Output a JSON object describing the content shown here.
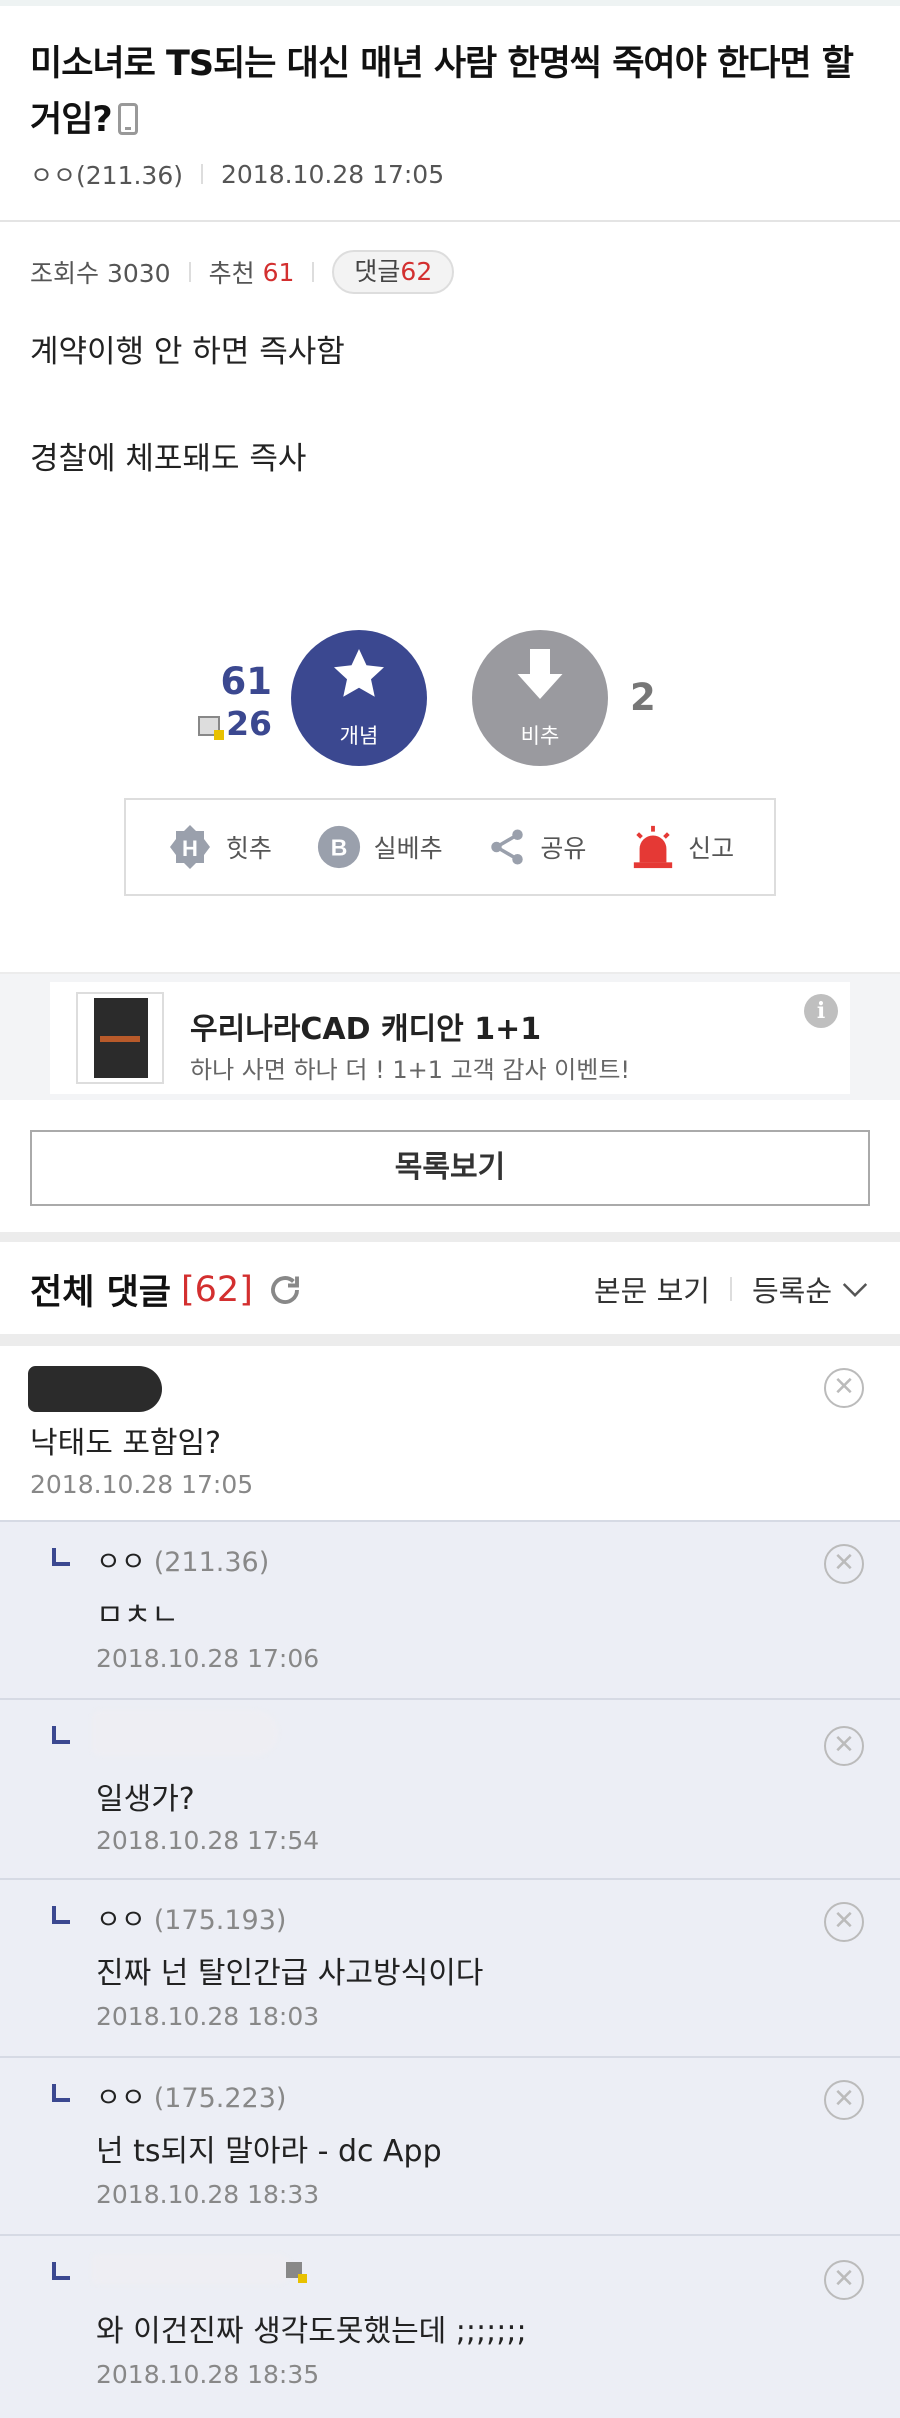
{
  "post": {
    "title": "미소녀로 TS되는 대신 매년 사람 한명씩 죽여야 한다면 할거임?",
    "author": "ㅇㅇ(211.36)",
    "date": "2018.10.28 17:05",
    "views_label": "조회수 3030",
    "recommend_label": "추천",
    "recommend_count": "61",
    "comments_label": "댓글",
    "comments_count": "62",
    "body_line1": "계약이행 안 하면 즉사함",
    "body_line2": "경찰에 체포돼도 즉사"
  },
  "vote": {
    "up_count": "61",
    "fix_count": "26",
    "up_label": "개념",
    "down_label": "비추",
    "down_count": "2"
  },
  "actions": {
    "hit": "힛추",
    "real": "실베추",
    "share": "공유",
    "report": "신고"
  },
  "ad": {
    "title": "우리나라CAD 캐디안 1+1",
    "subtitle": "하나 사면 하나 더 ! 1+1 고객 감사 이벤트!",
    "info_icon": "i"
  },
  "list_button": "목록보기",
  "comments_header": {
    "title": "전체 댓글",
    "count": "[62]",
    "view_body": "본문 보기",
    "sort": "등록순"
  },
  "comments": [
    {
      "nick": "",
      "ip": "",
      "text": "낙태도 포함임?",
      "date": "2018.10.28 17:05",
      "reply": false
    },
    {
      "nick": "ㅇㅇ",
      "ip": "(211.36)",
      "text": "ㅁㅊㄴ",
      "date": "2018.10.28 17:06",
      "reply": true
    },
    {
      "nick": "",
      "ip": "",
      "text": "일생가?",
      "date": "2018.10.28 17:54",
      "reply": true
    },
    {
      "nick": "ㅇㅇ",
      "ip": "(175.193)",
      "text": "진짜 넌 탈인간급 사고방식이다",
      "date": "2018.10.28 18:03",
      "reply": true
    },
    {
      "nick": "ㅇㅇ",
      "ip": "(175.223)",
      "text": "넌 ts되지 말아라 - dc App",
      "date": "2018.10.28 18:33",
      "reply": true
    },
    {
      "nick": "",
      "ip": "",
      "text": "와 이건진짜 생각도못했는데 ;;;;;;;",
      "date": "2018.10.28 18:35",
      "reply": true
    }
  ],
  "icons": {
    "mobile": "mobile-icon",
    "vote_up": "star-icon",
    "vote_down": "arrow-down-icon",
    "hit": "h-badge-icon",
    "real": "b-badge-icon",
    "share": "share-icon",
    "report": "siren-icon",
    "refresh": "refresh-icon",
    "sort": "chevron-down-icon",
    "delete": "close-circle-icon"
  },
  "colors": {
    "accent": "#3b4890",
    "red": "#d32f2f",
    "downvote": "#9a9a9f",
    "reply_bg": "#eceef5"
  }
}
